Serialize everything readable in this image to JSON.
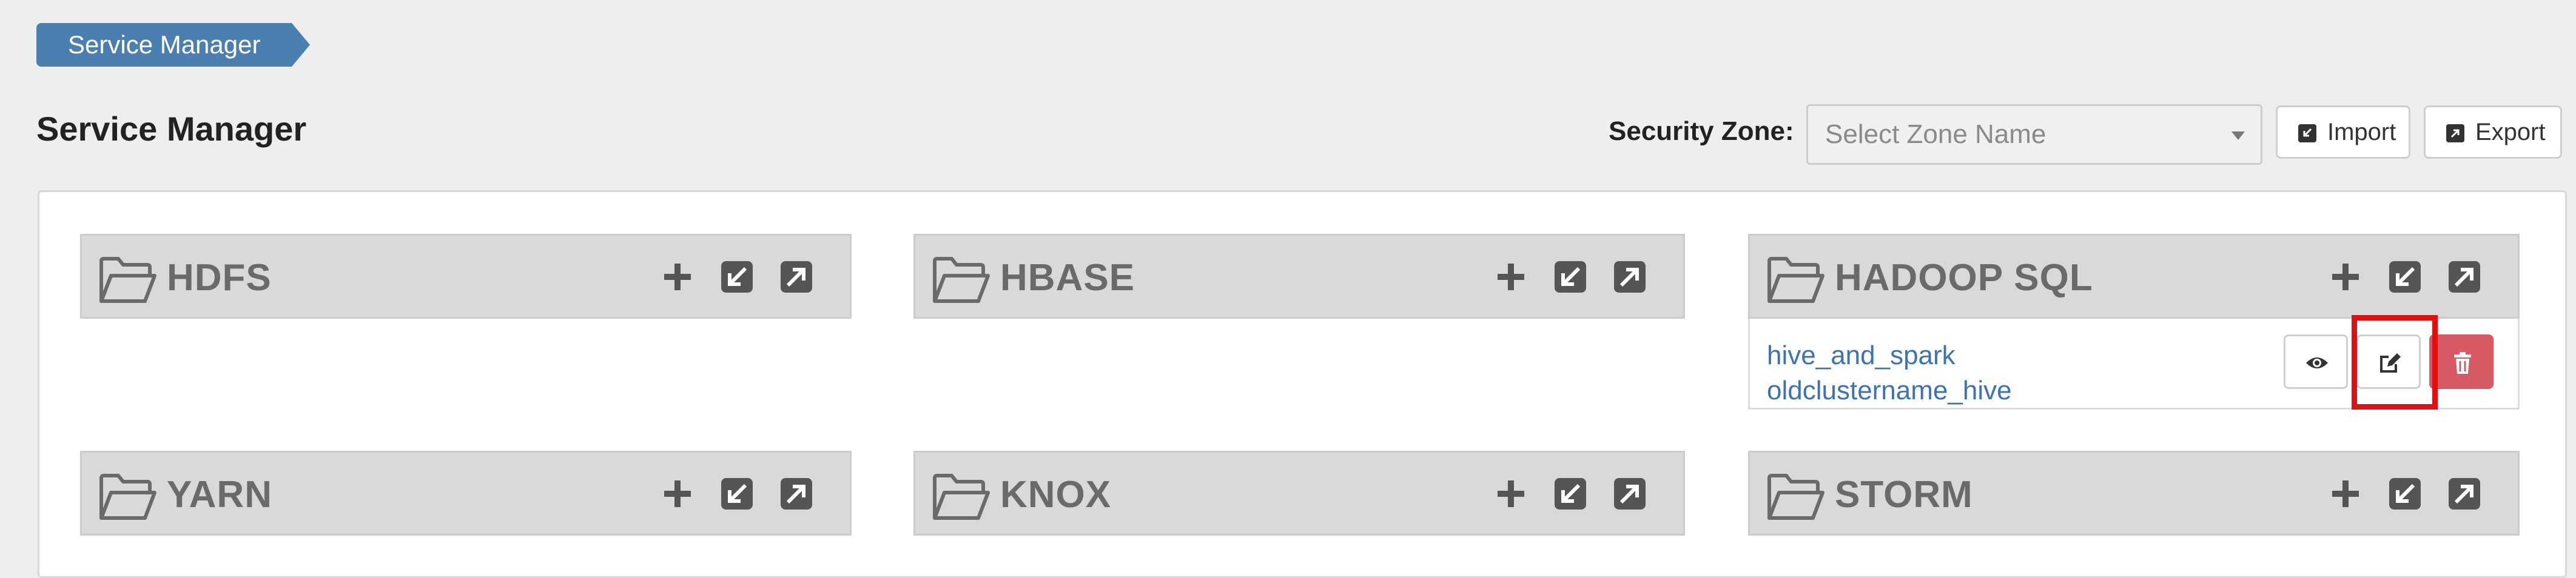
{
  "breadcrumb": {
    "label": "Service Manager"
  },
  "header": {
    "title": "Service Manager",
    "zone_label": "Security Zone:",
    "zone_placeholder": "Select Zone Name",
    "import_label": "Import",
    "export_label": "Export"
  },
  "services": [
    {
      "name": "HDFS",
      "repos": []
    },
    {
      "name": "HBASE",
      "repos": []
    },
    {
      "name": "HADOOP SQL",
      "repos": [
        "hive_and_spark",
        "oldclustername_hive"
      ]
    },
    {
      "name": "YARN",
      "repos": []
    },
    {
      "name": "KNOX",
      "repos": []
    },
    {
      "name": "STORM",
      "repos": []
    }
  ],
  "colors": {
    "breadcrumb": "#4a7fb0",
    "link": "#3d74b0",
    "delete": "#d65a63",
    "highlight": "#e01010",
    "card_header": "#d9d9d9"
  },
  "icons": {
    "service": "folder-open-icon",
    "add": "plus-icon",
    "import": "import-icon",
    "export": "export-icon",
    "view": "eye-icon",
    "edit": "edit-icon",
    "delete": "trash-icon"
  }
}
